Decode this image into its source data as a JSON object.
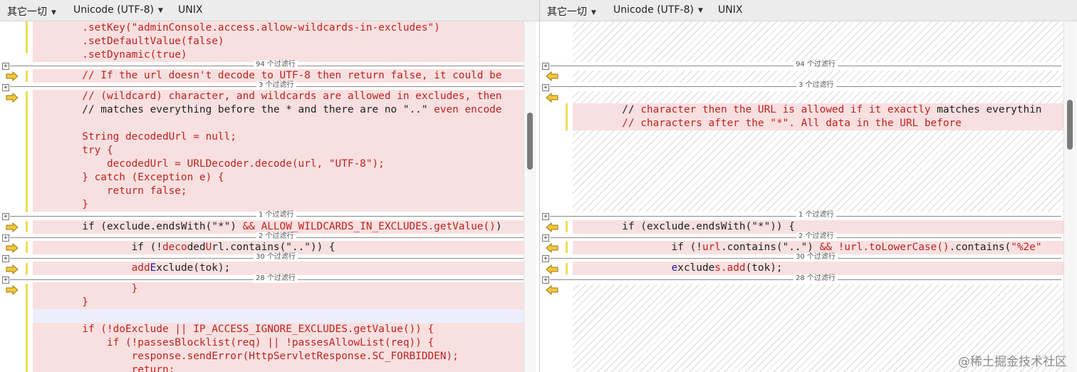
{
  "colors": {
    "diff_background": "#f8e0e0",
    "changed_text": "#c0221f",
    "inserted_text": "#1a1aa6",
    "change_marker": "#eedd55",
    "merge_arrow": "#f2c73c"
  },
  "left": {
    "toolbar": {
      "encoding_category": "其它一切",
      "encoding": "Unicode (UTF-8)",
      "line_ending": "UNIX"
    },
    "lines": [
      {
        "text": "        .setKey(\"adminConsole.access.allow-wildcards-in-excludes\")",
        "class": "k"
      },
      {
        "text": "        .setDefaultValue(false)",
        "class": "k"
      },
      {
        "text": "        .setDynamic(true)",
        "class": "k"
      },
      {
        "text": "        // If the url doesn't decode to UTF-8 then return false, it could be",
        "class": "k"
      },
      {
        "text": "        // (wildcard) character, and wildcards are allowed in excludes, then",
        "class": "k"
      },
      {
        "text": "        // matches everything before the * and there are no \"..\" even encode",
        "class": ""
      },
      {
        "text": "",
        "class": ""
      },
      {
        "text": "        String decodedUrl = null;",
        "class": "k"
      },
      {
        "text": "        try {",
        "class": "k"
      },
      {
        "text": "            decodedUrl = URLDecoder.decode(url, \"UTF-8\");",
        "class": "k"
      },
      {
        "text": "        } catch (Exception e) {",
        "class": "k"
      },
      {
        "text": "            return false;",
        "class": "k"
      },
      {
        "text": "        }",
        "class": "k"
      },
      {
        "text": "        if (exclude.endsWith(\"*\") && ALLOW_WILDCARDS_IN_EXCLUDES.getValue())",
        "class": ""
      },
      {
        "text": "                if (!decodedUrl.contains(\"..\")) {",
        "class": ""
      },
      {
        "text": "                addExclude(tok);",
        "class": ""
      },
      {
        "text": "                }",
        "class": "k"
      },
      {
        "text": "        }",
        "class": "k"
      },
      {
        "text": "",
        "class": ""
      },
      {
        "text": "        if (!doExclude || IP_ACCESS_IGNORE_EXCLUDES.getValue()) {",
        "class": "k"
      },
      {
        "text": "            if (!passesBlocklist(req) || !passesAllowList(req)) {",
        "class": "k"
      },
      {
        "text": "                response.sendError(HttpServletResponse.SC_FORBIDDEN);",
        "class": "k"
      },
      {
        "text": "                return;",
        "class": "k"
      }
    ],
    "segments": {
      "l5_plain": "        // matches everything before the * and there are no \"..\"",
      "l5_red": " even encode",
      "l13_plain": "        if (exclude.endsWith(\"*\") ",
      "l13_red": "&& ALLOW_WILDCARDS_IN_EXCLUDES.getValue()",
      "l13_tail": ")",
      "l14_a": "                if (!",
      "l14_b": "deco",
      "l14_c": "ded",
      "l14_d": "U",
      "l14_e": "rl.contains(\"..\")) {",
      "l15_a": "                ",
      "l15_b": "add",
      "l15_c": "E",
      "l15_d": "xclude(tok);"
    },
    "folds": [
      "94 个过滤行",
      "3 个过滤行",
      "1 个过滤行",
      "2 个过滤行",
      "30 个过滤行",
      "28 个过滤行"
    ]
  },
  "right": {
    "toolbar": {
      "encoding_category": "其它一切",
      "encoding": "Unicode (UTF-8)",
      "line_ending": "UNIX"
    },
    "comment_1a": "        // ",
    "comment_1b": "character then the URL is allowed if it exactly",
    "comment_1c": " matches everythin",
    "comment_2": "        // characters after the \"*\". All data in the URL before",
    "code_1": "        if (exclude.endsWith(\"*\")) {",
    "code_2a": "                if (!",
    "code_2b": "url",
    "code_2c": ".co",
    "code_2d": "ntains(\"..\") ",
    "code_2e": "&& !url.toLowerCase()",
    "code_2f": ".contains(",
    "code_2g": "\"%2e\"",
    "code_3a": "                ",
    "code_3b": "e",
    "code_3c": "xclude",
    "code_3d": "s.add",
    "code_3e": "(tok);",
    "folds": [
      "94 个过滤行",
      "3 个过滤行",
      "1 个过滤行",
      "2 个过滤行",
      "30 个过滤行",
      "28 个过滤行"
    ]
  },
  "watermark": "@稀土掘金技术社区"
}
